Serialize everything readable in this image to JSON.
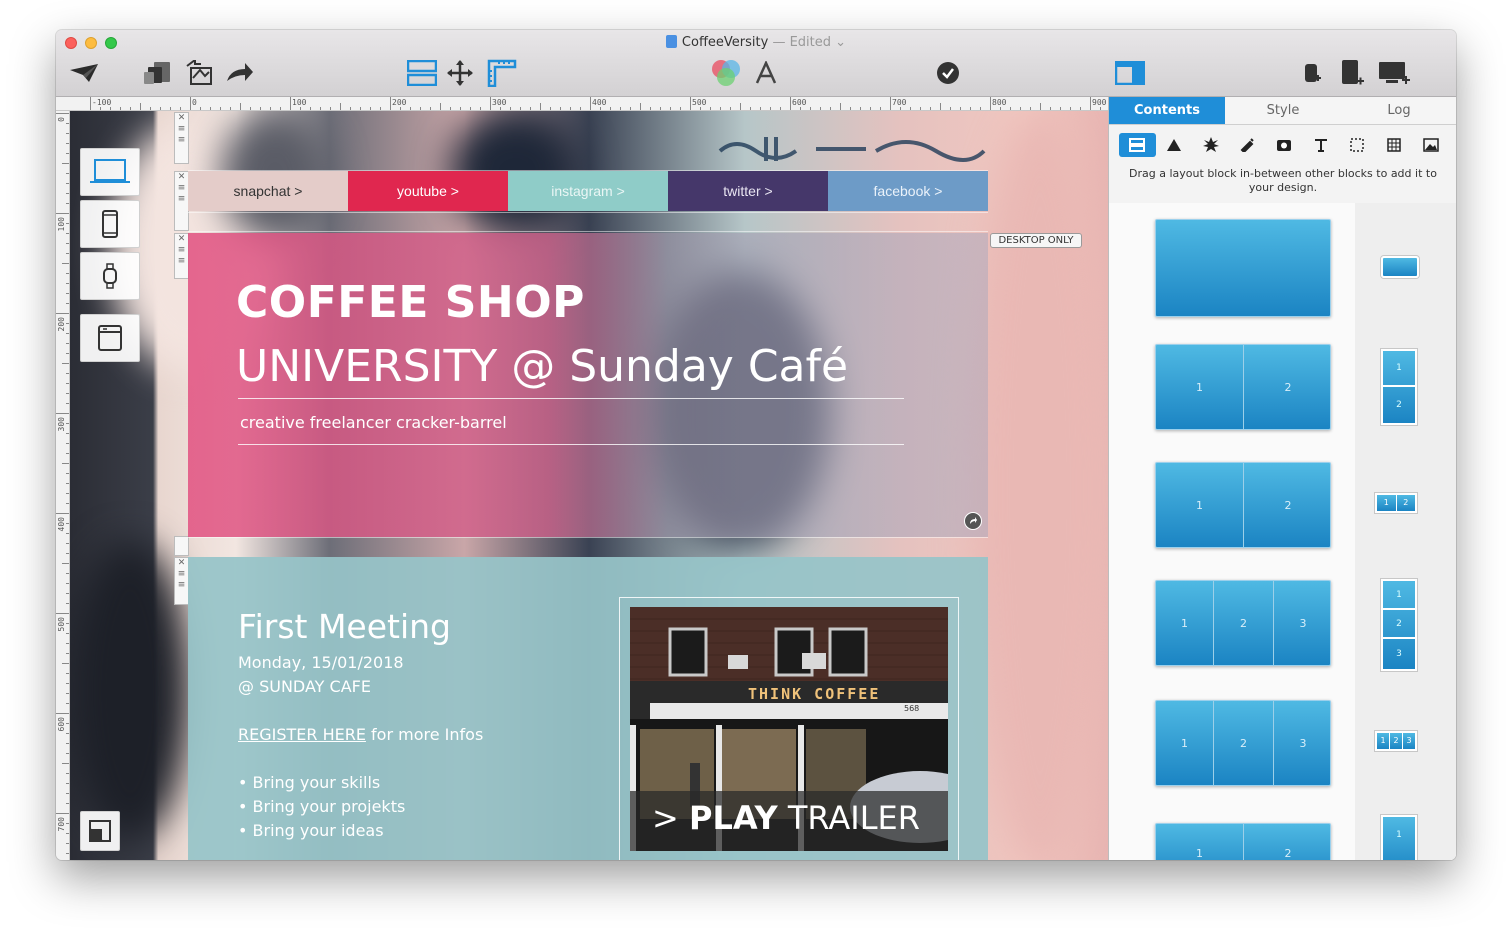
{
  "window": {
    "title": "CoffeeVersity",
    "edited": "— Edited"
  },
  "ruler": {
    "top": [
      "-100",
      "0",
      "100",
      "200",
      "300",
      "400",
      "500",
      "600",
      "700",
      "800",
      "900"
    ],
    "left": [
      "0",
      "100",
      "200",
      "300",
      "400",
      "500",
      "600",
      "700"
    ]
  },
  "social": [
    {
      "label": "snapchat >",
      "bg": "#e4ccc9",
      "fg": "#333333"
    },
    {
      "label": "youtube >",
      "bg": "#e0274f",
      "fg": "#ffffff"
    },
    {
      "label": "instagram >",
      "bg": "#8fccc8",
      "fg": "#eaf6f5"
    },
    {
      "label": "twitter >",
      "bg": "#45376a",
      "fg": "#e8e4f1"
    },
    {
      "label": "facebook >",
      "bg": "#6d9bc7",
      "fg": "#eaf2fa"
    }
  ],
  "badge": "DESKTOP ONLY",
  "hero": {
    "title": "COFFEE SHOP",
    "subtitle": "UNIVERSITY @ Sunday Café",
    "tagline": "creative freelancer cracker-barrel"
  },
  "meeting": {
    "title": "First Meeting",
    "date": "Monday, 15/01/2018",
    "place": "@ SUNDAY CAFE",
    "register_link": "REGISTER HERE",
    "register_suffix": " for more Infos",
    "bullets": [
      "• Bring your skills",
      "• Bring your projekts",
      "• Bring your ideas"
    ],
    "video_sign": "THINK COFFEE",
    "video_number": "568",
    "play_prefix": "> ",
    "play_bold": "PLAY",
    "play_rest": " TRAILER"
  },
  "sidebar": {
    "tabs": [
      "Contents",
      "Style",
      "Log"
    ],
    "active_tab": "Contents",
    "hint": "Drag a layout block in-between other blocks to add it to your design.",
    "accent": "#1f8ed8"
  }
}
